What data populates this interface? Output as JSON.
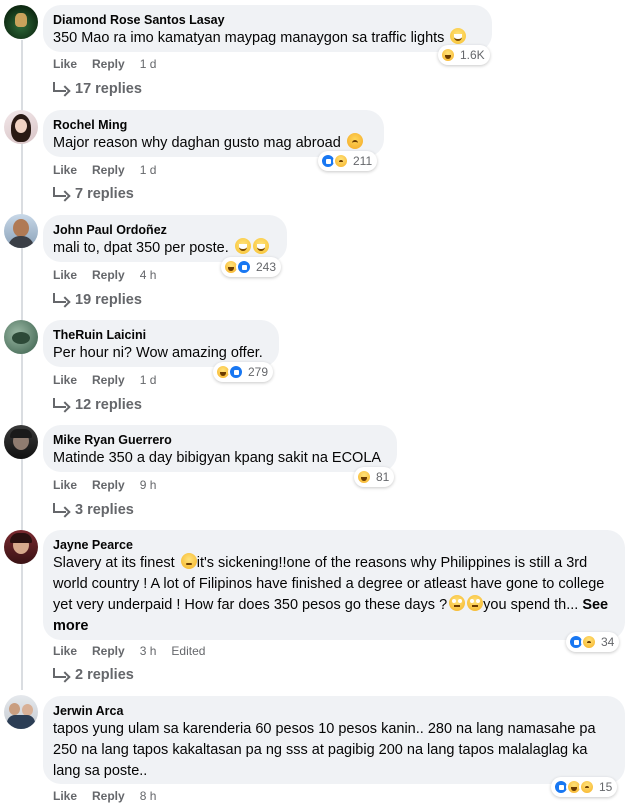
{
  "actions": {
    "like": "Like",
    "reply": "Reply",
    "edited": "Edited",
    "see_more": "See more"
  },
  "comments": [
    {
      "author": "Diamond Rose Santos Lasay",
      "text": "350 Mao ra imo kamatyan maypag manaygon sa traffic lights",
      "emoji": "grinning-sweat-emoji",
      "reactions": [
        "haha"
      ],
      "reaction_count": "1.6K",
      "time": "1 d",
      "replies": "17 replies"
    },
    {
      "author": "Rochel Ming",
      "text": "Major reason why daghan gusto mag abroad",
      "emoji": "frowning-emoji",
      "reactions": [
        "like",
        "sad"
      ],
      "reaction_count": "211",
      "time": "1 d",
      "replies": "7 replies"
    },
    {
      "author": "John Paul Ordoñez",
      "text": "mali to, dpat 350 per poste.",
      "emoji": "grinning-emoji",
      "emoji2": "grinning-emoji",
      "reactions": [
        "haha",
        "like"
      ],
      "reaction_count": "243",
      "time": "4 h",
      "replies": "19 replies"
    },
    {
      "author": "TheRuin Laicini",
      "text": "Per hour ni? Wow amazing offer.",
      "reactions": [
        "haha",
        "like"
      ],
      "reaction_count": "279",
      "time": "1 d",
      "replies": "12 replies"
    },
    {
      "author": "Mike Ryan Guerrero",
      "text": "Matinde 350 a day bibigyan kpang sakit na ECOLA",
      "reactions": [
        "haha"
      ],
      "reaction_count": "81",
      "time": "9 h",
      "replies": "3 replies"
    },
    {
      "author": "Jayne Pearce",
      "text_part1": "Slavery at its finest",
      "text_part2": "it's sickening!!one of the reasons why Philippines is still a 3rd world country ! A lot of Filipinos have finished a degree or atleast have gone to college yet very underpaid ! How far does 350 pesos go these days ?",
      "text_part3": "you spend th...",
      "reactions": [
        "like",
        "sad"
      ],
      "reaction_count": "34",
      "time": "3 h",
      "replies": "2 replies"
    },
    {
      "author": "Jerwin Arca",
      "text": "tapos yung ulam sa karenderia 60 pesos 10 pesos kanin.. 280 na lang namasahe pa 250 na lang tapos kakaltasan pa ng sss at pagibig 200 na lang tapos malalaglag ka lang sa poste..",
      "reactions": [
        "like",
        "haha",
        "sad"
      ],
      "reaction_count": "15",
      "time": "8 h"
    }
  ]
}
